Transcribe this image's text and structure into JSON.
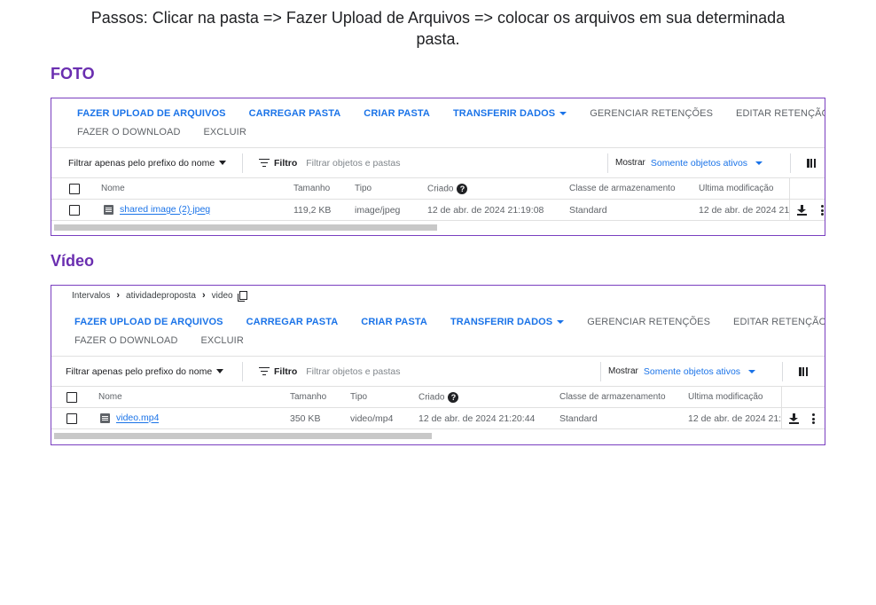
{
  "instructions": {
    "line1": "Passos: Clicar na pasta => Fazer Upload de Arquivos => colocar os arquivos em sua determinada",
    "line2": "pasta."
  },
  "colors": {
    "accent": "#1a73e8",
    "section_title": "#6a2eb0",
    "panel_border": "#7a3fc0"
  },
  "foto": {
    "section_title": "FOTO",
    "actions": {
      "upload": "FAZER UPLOAD DE ARQUIVOS",
      "load_folder": "CARREGAR PASTA",
      "create_folder": "CRIAR PASTA",
      "transfer": "TRANSFERIR DADOS",
      "manage_retentions": "GERENCIAR RETENÇÕES",
      "edit_retention": "EDITAR RETENÇÃO",
      "download": "FAZER O DOWNLOAD",
      "delete": "EXCLUIR"
    },
    "filter": {
      "prefix_label": "Filtrar apenas pelo prefixo do nome",
      "filter_label": "Filtro",
      "filter_placeholder": "Filtrar objetos e pastas",
      "show_label": "Mostrar",
      "show_value": "Somente objetos ativos"
    },
    "columns": {
      "name": "Nome",
      "size": "Tamanho",
      "type": "Tipo",
      "created": "Criado",
      "storage_class": "Classe de armazenamento",
      "last_modified": "Última modificação"
    },
    "rows": [
      {
        "name": "shared image (2).jpeg",
        "size": "119,2 KB",
        "type": "image/jpeg",
        "created": "12 de abr. de 2024 21:19:08",
        "storage_class": "Standard",
        "last_modified": "12 de abr. de 2024 21"
      }
    ]
  },
  "video": {
    "section_title": "Vídeo",
    "breadcrumb": [
      "Intervalos",
      "atividadeproposta",
      "video"
    ],
    "actions": {
      "upload": "FAZER UPLOAD DE ARQUIVOS",
      "load_folder": "CARREGAR PASTA",
      "create_folder": "CRIAR PASTA",
      "transfer": "TRANSFERIR DADOS",
      "manage_retentions": "GERENCIAR RETENÇÕES",
      "edit_retention": "EDITAR RETENÇÃO",
      "download": "FAZER O DOWNLOAD",
      "delete": "EXCLUIR"
    },
    "filter": {
      "prefix_label": "Filtrar apenas pelo prefixo do nome",
      "filter_label": "Filtro",
      "filter_placeholder": "Filtrar objetos e pastas",
      "show_label": "Mostrar",
      "show_value": "Somente objetos ativos"
    },
    "columns": {
      "name": "Nome",
      "size": "Tamanho",
      "type": "Tipo",
      "created": "Criado",
      "storage_class": "Classe de armazenamento",
      "last_modified": "Última modificação"
    },
    "rows": [
      {
        "name": "video.mp4",
        "size": "350 KB",
        "type": "video/mp4",
        "created": "12 de abr. de 2024 21:20:44",
        "storage_class": "Standard",
        "last_modified": "12 de abr. de 2024 21:"
      }
    ]
  }
}
